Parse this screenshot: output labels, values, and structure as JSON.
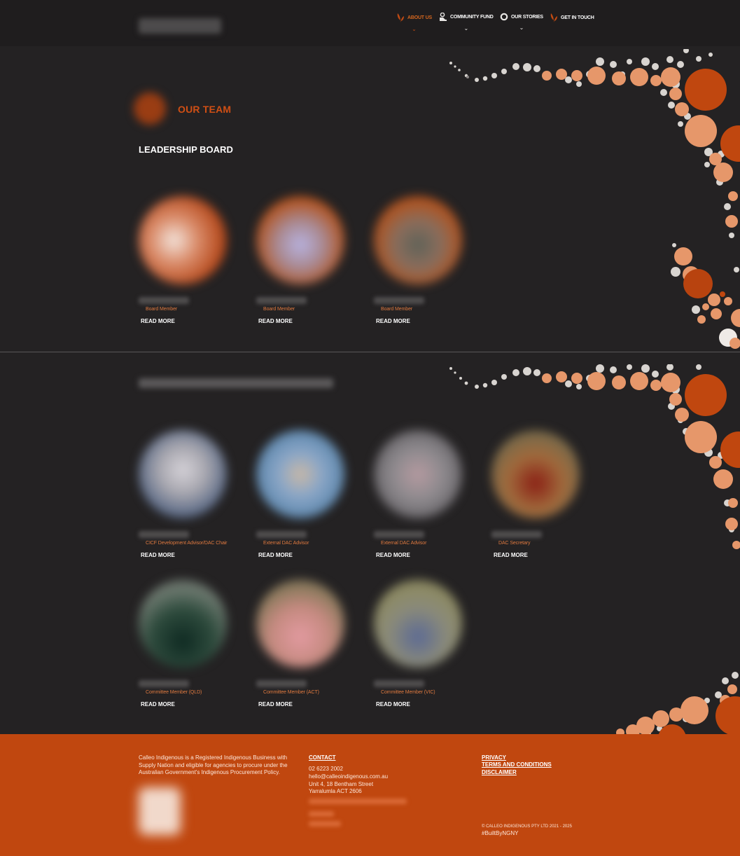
{
  "nav": {
    "items": [
      {
        "label": "ABOUT US",
        "icon": "leaf-icon",
        "active": true
      },
      {
        "label": "COMMUNITY FUND",
        "icon": "hand-coin-icon",
        "active": false
      },
      {
        "label": "OUR STORIES",
        "icon": "circle-ring-icon",
        "active": false
      },
      {
        "label": "GET IN TOUCH",
        "icon": "leaf-icon",
        "active": false
      }
    ],
    "chevron": "⌄"
  },
  "team": {
    "title": "OUR TEAM",
    "section1_title": "LEADERSHIP BOARD",
    "read_more": "READ MORE",
    "board": [
      {
        "role": "Board Member",
        "avatar_color": "#c96a45"
      },
      {
        "role": "Board Member",
        "avatar_color": "#a98a93"
      },
      {
        "role": "Board Member",
        "avatar_color": "#8a6d5c"
      }
    ],
    "committee_row1": [
      {
        "role": "CICF Development Advisor/DAC Chair",
        "avatar_color": "#7d7e86"
      },
      {
        "role": "External DAC Advisor",
        "avatar_color": "#5f88ad"
      },
      {
        "role": "External DAC Advisor",
        "avatar_color": "#807478"
      },
      {
        "role": "DAC Secretary",
        "avatar_color": "#8a5a32"
      }
    ],
    "committee_row2": [
      {
        "role": "Committee Member (QLD)",
        "avatar_color": "#405d4f"
      },
      {
        "role": "Committee Member (ACT)",
        "avatar_color": "#b77a7a"
      },
      {
        "role": "Committee Member (VIC)",
        "avatar_color": "#6d7480"
      }
    ]
  },
  "footer": {
    "about": "Calleo Indigenous is a Registered Indigenous Business with Supply Nation and eligible for agencies to procure under the Australian Government's Indigenous Procurement Policy.",
    "contact_heading": "CONTACT",
    "phone": "02 6223 2002",
    "email": "hello@calleoindigenous.com.au",
    "address1": "Unit 4, 18 Bentham Street",
    "address2": "Yarralumla ACT 2606",
    "links": [
      "PRIVACY",
      "TERMS AND CONDITIONS",
      "DISCLAIMER"
    ],
    "copyright": "© CALLEO INDIGENOUS PTY LTD 2021 - 2025",
    "hashtag": "#BuiltByNGNY"
  },
  "colors": {
    "accent": "#c0470f",
    "accent_light": "#e6976a",
    "background": "#242223"
  }
}
